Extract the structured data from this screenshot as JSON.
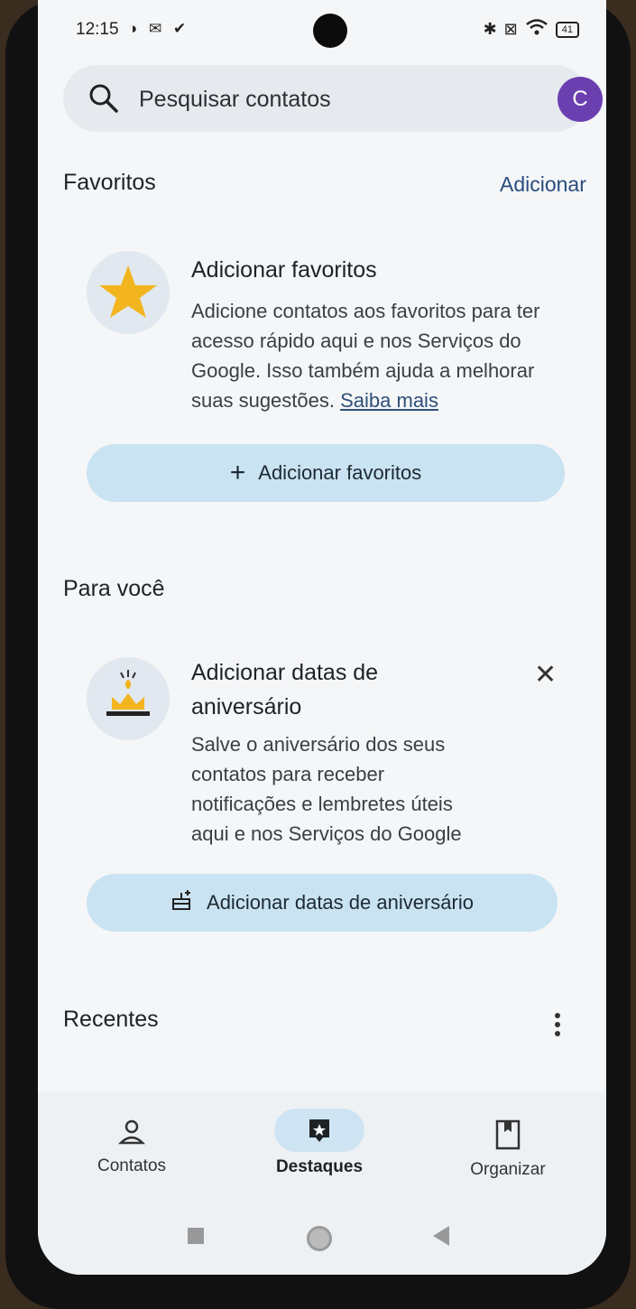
{
  "status_bar": {
    "time": "12:15",
    "battery": "41"
  },
  "search": {
    "placeholder": "Pesquisar contatos",
    "avatar_letter": "C"
  },
  "favorites": {
    "title": "Favoritos",
    "add_link": "Adicionar",
    "card_title": "Adicionar favoritos",
    "card_body": "Adicione contatos aos favoritos para ter acesso rápido aqui e nos Serviços do Google. Isso também ajuda a melhorar suas sugestões.",
    "learn_more": "Saiba mais",
    "button": "Adicionar favoritos"
  },
  "for_you": {
    "title": "Para você",
    "card_title": "Adicionar datas de aniversário",
    "card_body": "Salve o aniversário dos seus contatos para receber notificações e lembretes úteis aqui e nos Serviços do Google",
    "button": "Adicionar datas de aniversário"
  },
  "recents": {
    "title": "Recentes"
  },
  "bottom_nav": {
    "items": [
      {
        "label": "Contatos",
        "icon": "person-icon"
      },
      {
        "label": "Destaques",
        "icon": "highlights-icon",
        "active": true
      },
      {
        "label": "Organizar",
        "icon": "bookmark-icon"
      }
    ]
  },
  "colors": {
    "accent": "#c9e3f2",
    "avatar": "#6a3fb0",
    "link": "#2b4c7e"
  }
}
